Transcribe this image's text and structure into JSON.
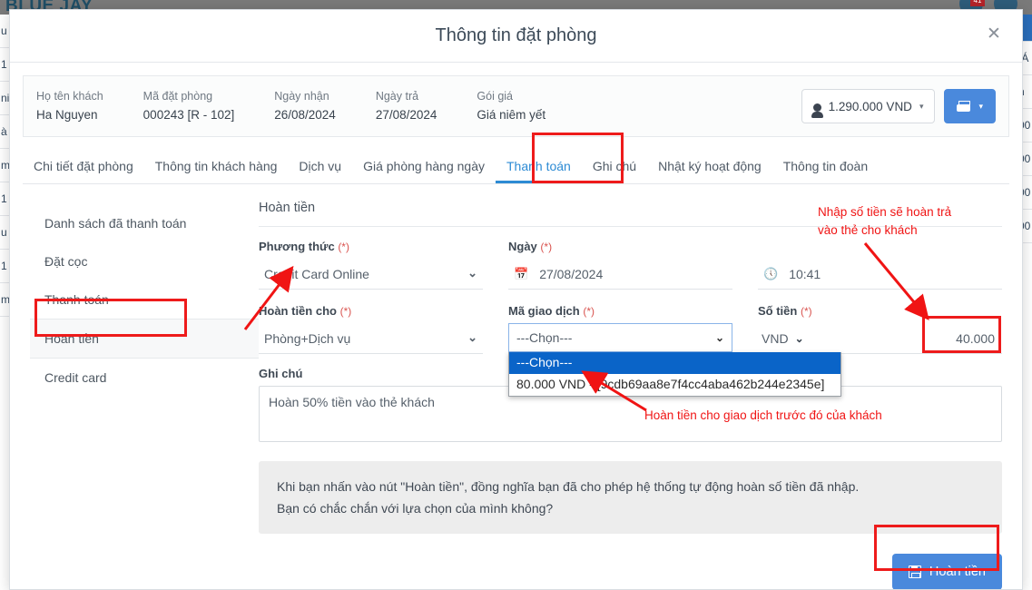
{
  "background": {
    "brand": "BLUE JAY",
    "notification_count": "41",
    "left_table_rows": [
      "u",
      "1",
      "ni",
      "à",
      "m",
      "1",
      "u",
      "1",
      "m"
    ],
    "right_table_rows": [
      "IÁ",
      "n",
      "00",
      "00",
      "00",
      "00"
    ]
  },
  "modal": {
    "title": "Thông tin đặt phòng",
    "close_label": "✕"
  },
  "summary": {
    "fields": [
      {
        "label": "Họ tên khách",
        "value": "Ha Nguyen"
      },
      {
        "label": "Mã đặt phòng",
        "value": "000243 [R - 102]"
      },
      {
        "label": "Ngày nhận",
        "value": "26/08/2024"
      },
      {
        "label": "Ngày trả",
        "value": "27/08/2024"
      },
      {
        "label": "Gói giá",
        "value": "Giá niêm yết"
      }
    ],
    "amount_button": "1.290.000 VND",
    "amount_caret": "▾",
    "print_caret": "▾"
  },
  "tabs": [
    {
      "label": "Chi tiết đặt phòng",
      "active": false
    },
    {
      "label": "Thông tin khách hàng",
      "active": false
    },
    {
      "label": "Dịch vụ",
      "active": false
    },
    {
      "label": "Giá phòng hàng ngày",
      "active": false
    },
    {
      "label": "Thanh toán",
      "active": true
    },
    {
      "label": "Ghi chú",
      "active": false
    },
    {
      "label": "Nhật ký hoạt động",
      "active": false
    },
    {
      "label": "Thông tin đoàn",
      "active": false
    }
  ],
  "side_nav": [
    {
      "label": "Danh sách đã thanh toán",
      "active": false
    },
    {
      "label": "Đặt cọc",
      "active": false
    },
    {
      "label": "Thanh toán",
      "active": false
    },
    {
      "label": "Hoàn tiền",
      "active": true
    },
    {
      "label": "Credit card",
      "active": false
    }
  ],
  "form": {
    "section_title": "Hoàn tiền",
    "required_mark": "(*)",
    "method": {
      "label": "Phương thức",
      "value": "Credit Card Online",
      "caret": "⌄"
    },
    "date": {
      "label": "Ngày",
      "value": "27/08/2024",
      "icon": "calendar-icon"
    },
    "time": {
      "value": "10:41",
      "icon": "clock-icon"
    },
    "refund_for": {
      "label": "Hoàn tiền cho",
      "value": "Phòng+Dịch vụ",
      "caret": "⌄"
    },
    "transaction": {
      "label": "Mã giao dịch",
      "value": "---Chọn---",
      "caret": "⌄",
      "options": [
        {
          "label": "---Chọn---",
          "selected": true
        },
        {
          "label": "80.000 VND - [9cdb69aa8e7f4cc4aba462b244e2345e]",
          "selected": false
        }
      ]
    },
    "amount": {
      "label": "Số tiền",
      "currency": "VND",
      "currency_caret": "⌄",
      "value": "40.000"
    },
    "note": {
      "label": "Ghi chú",
      "value": "Hoàn 50% tiền vào thẻ khách"
    },
    "warning_line1": "Khi bạn nhấn vào nút \"Hoàn tiền\", đồng nghĩa bạn đã cho phép hệ thống tự động hoàn số tiền đã nhập.",
    "warning_line2": "Bạn có chắc chắn với lựa chọn của mình không?",
    "save_button": "Hoàn tiền"
  },
  "annotations": {
    "note_amount": "Nhập số tiền sẽ hoàn trả\nvào thẻ cho khách",
    "note_transaction": "Hoàn tiền cho giao dịch trước đó của khách",
    "color": "#f01414"
  }
}
